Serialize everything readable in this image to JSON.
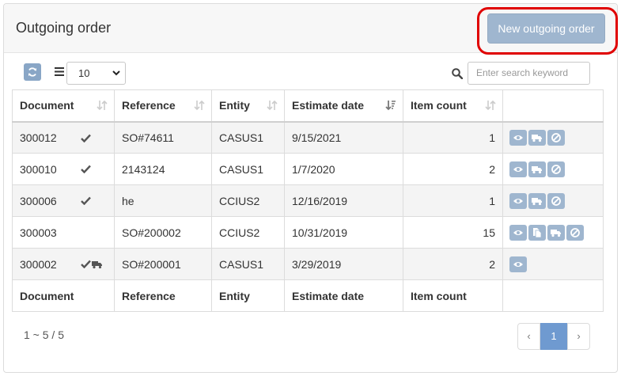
{
  "header": {
    "title": "Outgoing order",
    "new_button_label": "New outgoing order"
  },
  "toolbar": {
    "page_size": "10",
    "search_placeholder": "Enter search keyword"
  },
  "table": {
    "columns": [
      "Document",
      "Reference",
      "Entity",
      "Estimate date",
      "Item count"
    ],
    "rows": [
      {
        "document": "300012",
        "reference": "SO#74611",
        "entity": "CASUS1",
        "date": "9/15/2021",
        "count": "1"
      },
      {
        "document": "300010",
        "reference": "2143124",
        "entity": "CASUS1",
        "date": "1/7/2020",
        "count": "2"
      },
      {
        "document": "300006",
        "reference": "he",
        "entity": "CCIUS2",
        "date": "12/16/2019",
        "count": "1"
      },
      {
        "document": "300003",
        "reference": "SO#200002",
        "entity": "CCIUS2",
        "date": "10/31/2019",
        "count": "15"
      },
      {
        "document": "300002",
        "reference": "SO#200001",
        "entity": "CASUS1",
        "date": "3/29/2019",
        "count": "2"
      }
    ]
  },
  "footer": {
    "range_text": "1 ~ 5 / 5",
    "prev": "‹",
    "page": "1",
    "next": "›"
  },
  "colors": {
    "accent": "#6f9ad0",
    "action_button": "#9fb6cf",
    "highlight": "#e00000"
  }
}
